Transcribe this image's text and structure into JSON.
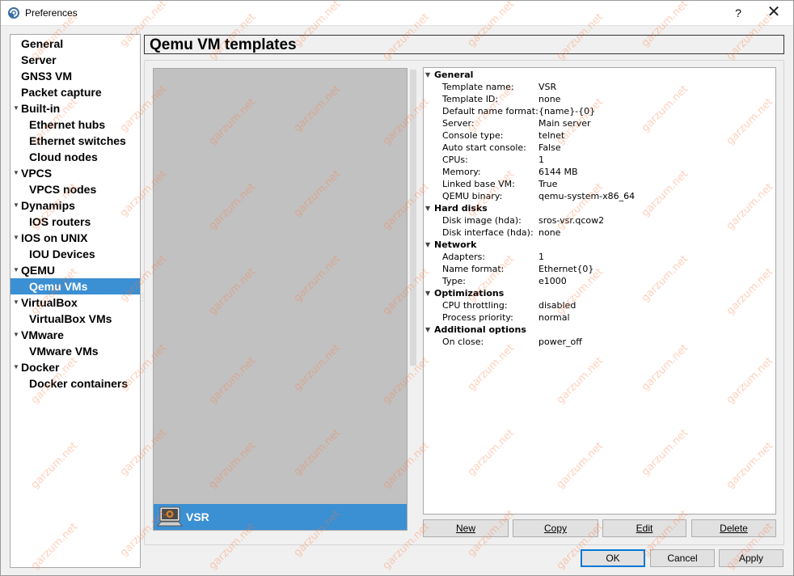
{
  "window": {
    "title": "Preferences",
    "help_label": "?",
    "close_label": "✕"
  },
  "sidebar": {
    "items": [
      {
        "label": "General",
        "level": 0,
        "expandable": false,
        "selected": false
      },
      {
        "label": "Server",
        "level": 0,
        "expandable": false,
        "selected": false
      },
      {
        "label": "GNS3 VM",
        "level": 0,
        "expandable": false,
        "selected": false
      },
      {
        "label": "Packet capture",
        "level": 0,
        "expandable": false,
        "selected": false
      },
      {
        "label": "Built-in",
        "level": 0,
        "expandable": true,
        "selected": false
      },
      {
        "label": "Ethernet hubs",
        "level": 1,
        "expandable": false,
        "selected": false
      },
      {
        "label": "Ethernet switches",
        "level": 1,
        "expandable": false,
        "selected": false
      },
      {
        "label": "Cloud nodes",
        "level": 1,
        "expandable": false,
        "selected": false
      },
      {
        "label": "VPCS",
        "level": 0,
        "expandable": true,
        "selected": false
      },
      {
        "label": "VPCS nodes",
        "level": 1,
        "expandable": false,
        "selected": false
      },
      {
        "label": "Dynamips",
        "level": 0,
        "expandable": true,
        "selected": false
      },
      {
        "label": "IOS routers",
        "level": 1,
        "expandable": false,
        "selected": false
      },
      {
        "label": "IOS on UNIX",
        "level": 0,
        "expandable": true,
        "selected": false
      },
      {
        "label": "IOU Devices",
        "level": 1,
        "expandable": false,
        "selected": false
      },
      {
        "label": "QEMU",
        "level": 0,
        "expandable": true,
        "selected": false
      },
      {
        "label": "Qemu VMs",
        "level": 1,
        "expandable": false,
        "selected": true
      },
      {
        "label": "VirtualBox",
        "level": 0,
        "expandable": true,
        "selected": false
      },
      {
        "label": "VirtualBox VMs",
        "level": 1,
        "expandable": false,
        "selected": false
      },
      {
        "label": "VMware",
        "level": 0,
        "expandable": true,
        "selected": false
      },
      {
        "label": "VMware VMs",
        "level": 1,
        "expandable": false,
        "selected": false
      },
      {
        "label": "Docker",
        "level": 0,
        "expandable": true,
        "selected": false
      },
      {
        "label": "Docker containers",
        "level": 1,
        "expandable": false,
        "selected": false
      }
    ]
  },
  "page": {
    "title": "Qemu VM templates"
  },
  "vm_list": {
    "items": [
      {
        "label": "VSR",
        "icon": "qemu-vm-icon",
        "selected": true
      }
    ]
  },
  "properties": {
    "rows": [
      {
        "type": "section",
        "label": "General"
      },
      {
        "type": "prop",
        "key": "Template name:",
        "value": "VSR"
      },
      {
        "type": "prop",
        "key": "Template ID:",
        "value": "none"
      },
      {
        "type": "prop",
        "key": "Default name format:",
        "value": "{name}-{0}"
      },
      {
        "type": "prop",
        "key": "Server:",
        "value": "Main server"
      },
      {
        "type": "prop",
        "key": "Console type:",
        "value": "telnet"
      },
      {
        "type": "prop",
        "key": "Auto start console:",
        "value": "False"
      },
      {
        "type": "prop",
        "key": "CPUs:",
        "value": "1"
      },
      {
        "type": "prop",
        "key": "Memory:",
        "value": "6144 MB"
      },
      {
        "type": "prop",
        "key": "Linked base VM:",
        "value": "True"
      },
      {
        "type": "prop",
        "key": "QEMU binary:",
        "value": "qemu-system-x86_64"
      },
      {
        "type": "section",
        "label": "Hard disks"
      },
      {
        "type": "prop",
        "key": "Disk image (hda):",
        "value": "sros-vsr.qcow2"
      },
      {
        "type": "prop",
        "key": "Disk interface (hda):",
        "value": "none"
      },
      {
        "type": "section",
        "label": "Network"
      },
      {
        "type": "prop",
        "key": "Adapters:",
        "value": "1"
      },
      {
        "type": "prop",
        "key": "Name format:",
        "value": "Ethernet{0}"
      },
      {
        "type": "prop",
        "key": "Type:",
        "value": "e1000"
      },
      {
        "type": "section",
        "label": "Optimizations"
      },
      {
        "type": "prop",
        "key": "CPU throttling:",
        "value": "disabled"
      },
      {
        "type": "prop",
        "key": "Process priority:",
        "value": "normal"
      },
      {
        "type": "section",
        "label": "Additional options"
      },
      {
        "type": "prop",
        "key": "On close:",
        "value": "power_off"
      }
    ]
  },
  "template_buttons": {
    "new": "New",
    "copy": "Copy",
    "edit": "Edit",
    "delete": "Delete"
  },
  "dialog_buttons": {
    "ok": "OK",
    "cancel": "Cancel",
    "apply": "Apply"
  },
  "watermark": "garzum.net",
  "colors": {
    "selection": "#3b8fd3",
    "list_background": "#c1c1c1",
    "watermark": "#ff783c"
  }
}
